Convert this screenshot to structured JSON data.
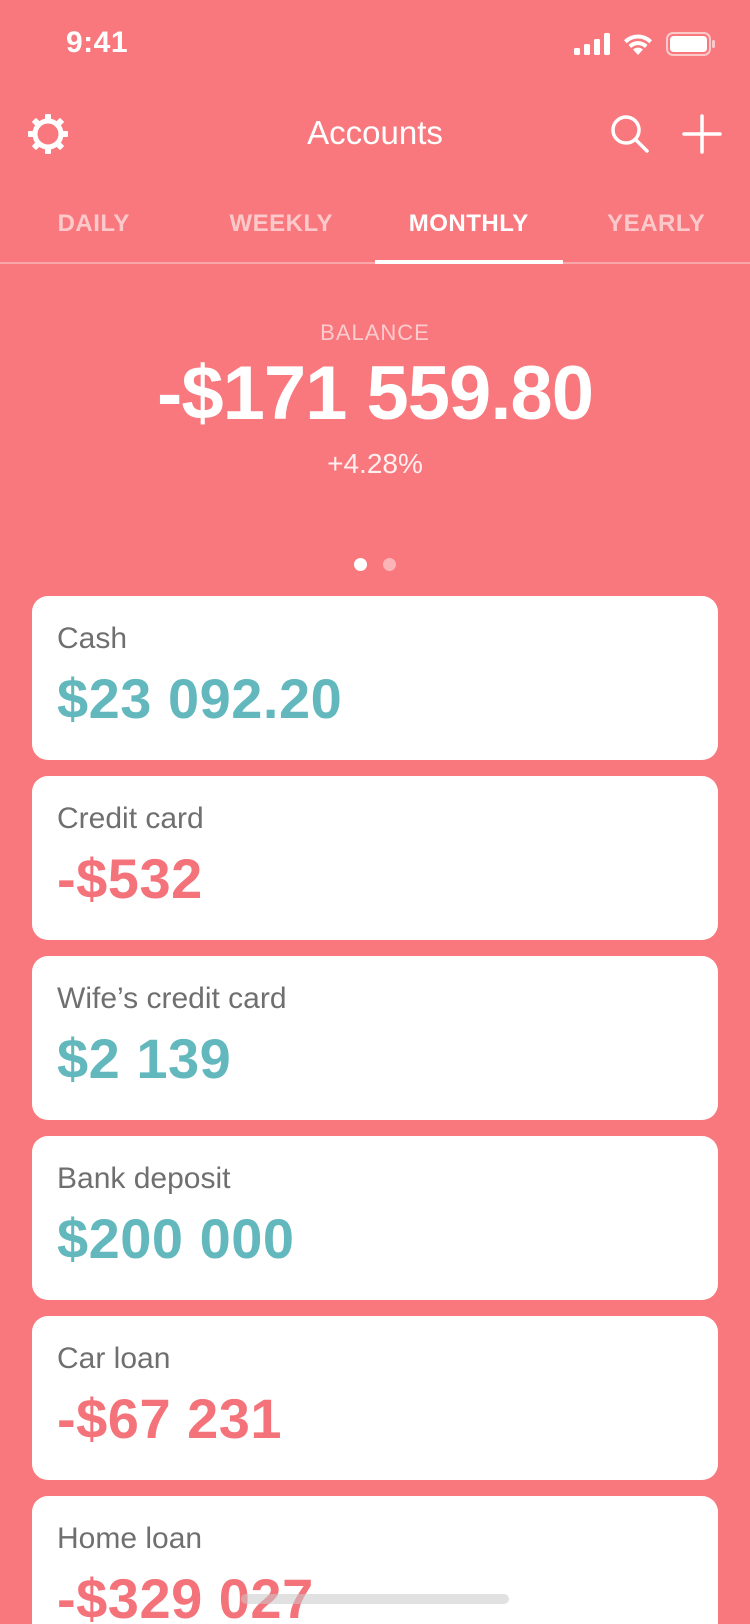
{
  "status_bar": {
    "time": "9:41"
  },
  "header": {
    "title": "Accounts"
  },
  "tabs": [
    {
      "label": "DAILY",
      "active": false
    },
    {
      "label": "WEEKLY",
      "active": false
    },
    {
      "label": "MONTHLY",
      "active": true
    },
    {
      "label": "YEARLY",
      "active": false
    }
  ],
  "balance": {
    "label": "BALANCE",
    "value": "-$171 559.80",
    "change": "+4.28%"
  },
  "pager": {
    "page_count": 2,
    "active_page": 1
  },
  "accounts": [
    {
      "name": "Cash",
      "amount": "$23 092.20",
      "sign": "positive"
    },
    {
      "name": "Credit card",
      "amount": "-$532",
      "sign": "negative"
    },
    {
      "name": "Wife’s credit card",
      "amount": "$2 139",
      "sign": "positive"
    },
    {
      "name": "Bank deposit",
      "amount": "$200 000",
      "sign": "positive"
    },
    {
      "name": "Car loan",
      "amount": "-$67 231",
      "sign": "negative"
    },
    {
      "name": "Home loan",
      "amount": "-$329 027",
      "sign": "negative"
    }
  ],
  "icons": {
    "settings": "gear-icon",
    "search": "search-icon",
    "add": "plus-icon",
    "signal": "cellular-signal-icon",
    "wifi": "wifi-icon",
    "battery": "battery-icon"
  },
  "colors": {
    "background": "#f8787d",
    "positive_amount": "#62b8bd",
    "negative_amount": "#f4737a",
    "card": "#ffffff"
  }
}
